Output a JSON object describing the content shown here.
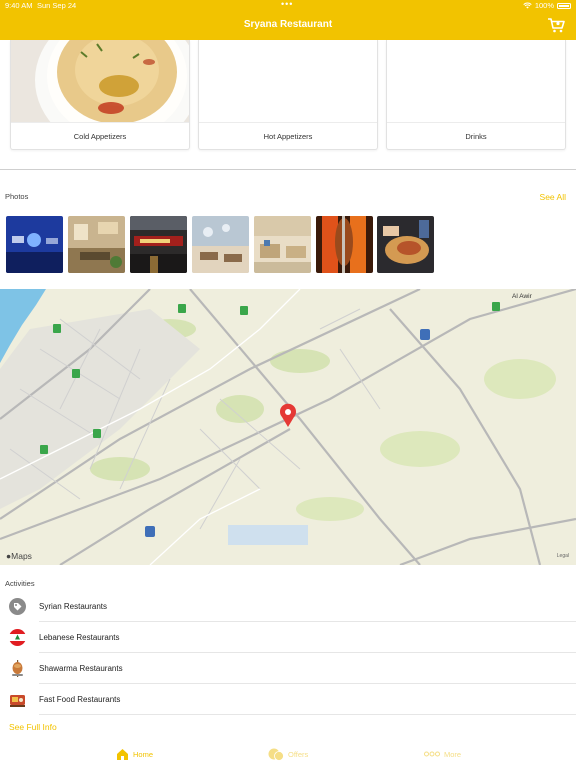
{
  "status_bar": {
    "time": "9:40 AM",
    "date": "Sun Sep 24",
    "battery": "100%"
  },
  "nav": {
    "title": "Sryana Restaurant",
    "cart_icon": "cart-icon"
  },
  "categories": [
    {
      "label": "Cold Appetizers"
    },
    {
      "label": "Hot Appetizers"
    },
    {
      "label": "Drinks"
    }
  ],
  "photos": {
    "title": "Photos",
    "see_all": "See All",
    "count": 7
  },
  "map": {
    "place_label": "Al Awir",
    "logo": "Maps",
    "legal": "Legal"
  },
  "activities": {
    "title": "Activities",
    "items": [
      {
        "label": "Syrian Restaurants",
        "icon": "tag-icon"
      },
      {
        "label": "Lebanese Restaurants",
        "icon": "lebanon-flag-icon"
      },
      {
        "label": "Shawarma Restaurants",
        "icon": "shawarma-icon"
      },
      {
        "label": "Fast Food Restaurants",
        "icon": "fast-food-icon"
      }
    ],
    "full_info": "See Full Info"
  },
  "tabs": [
    {
      "label": "Home",
      "icon": "home-icon",
      "active": true
    },
    {
      "label": "Offers",
      "icon": "offers-icon",
      "active": false
    },
    {
      "label": "More",
      "icon": "more-icon",
      "active": false
    }
  ],
  "colors": {
    "accent": "#f2c300",
    "map_pin": "#e53935"
  }
}
